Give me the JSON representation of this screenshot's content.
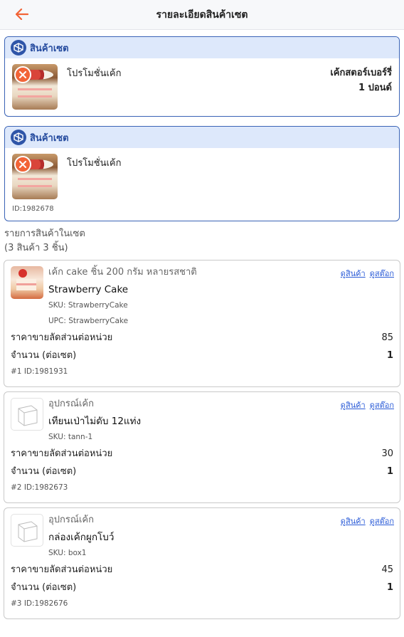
{
  "header": {
    "title": "รายละเอียดสินค้าเซต",
    "back_icon": "arrow-left-icon",
    "accent": "#f26437"
  },
  "sets": [
    {
      "title": "สินค้าเซต",
      "product_name": "โปรโมชั่นเค้ก",
      "variant_line1": "เค้กสตอร์เบอร์รี่",
      "variant_line2": "1 ปอนด์",
      "id": ""
    },
    {
      "title": "สินค้าเซต",
      "product_name": "โปรโมชั่นเค้ก",
      "variant_line1": "",
      "variant_line2": "",
      "id": "ID:1982678"
    }
  ],
  "list": {
    "label": "รายการสินค้าในเซต",
    "count": "(3 สินค้า 3 ชิ้น)"
  },
  "items": [
    {
      "category": "เค้ก cake ชิ้น 200 กรัม หลายรสชาติ",
      "name": "Strawberry Cake",
      "sku": "SKU: StrawberryCake",
      "upc": "UPC: StrawberryCake",
      "price_label": "ราคาขายลัดส่วนต่อหน่วย",
      "price": "85",
      "qty_label": "จำนวน (ต่อเซต)",
      "qty": "1",
      "ref": "#1 ID:1981931",
      "link_product": "ดูสินค้า",
      "link_stock": "ดูสต๊อก"
    },
    {
      "category": "อุปกรณ์เค้ก",
      "name": "เทียนเป่าไม่ดับ 12แท่ง",
      "sku": "SKU: tann-1",
      "upc": "",
      "price_label": "ราคาขายลัดส่วนต่อหน่วย",
      "price": "30",
      "qty_label": "จำนวน (ต่อเซต)",
      "qty": "1",
      "ref": "#2 ID:1982673",
      "link_product": "ดูสินค้า",
      "link_stock": "ดูสต๊อก"
    },
    {
      "category": "อุปกรณ์เค้ก",
      "name": "กล่องเค้กผูกโบว์",
      "sku": "SKU: box1",
      "upc": "",
      "price_label": "ราคาขายลัดส่วนต่อหน่วย",
      "price": "45",
      "qty_label": "จำนวน (ต่อเซต)",
      "qty": "1",
      "ref": "#3 ID:1982676",
      "link_product": "ดูสินค้า",
      "link_stock": "ดูสต๊อก"
    }
  ]
}
